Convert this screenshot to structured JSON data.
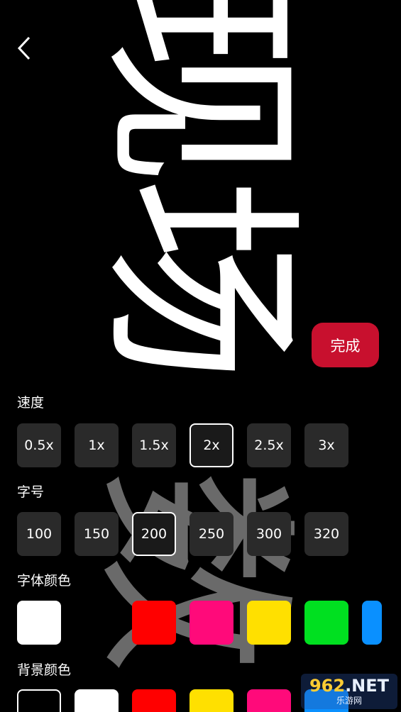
{
  "marquee": {
    "main_text": "现场",
    "trail_text": "数",
    "text_color": "#ffffff",
    "trail_color": "#6a6a6a"
  },
  "header": {
    "back_icon": "chevron-left-icon"
  },
  "actions": {
    "done_label": "完成",
    "done_color": "#c8102e"
  },
  "speed": {
    "label": "速度",
    "options": [
      "0.5x",
      "1x",
      "1.5x",
      "2x",
      "2.5x",
      "3x"
    ],
    "selected": "2x"
  },
  "font_size": {
    "label": "字号",
    "options": [
      "100",
      "150",
      "200",
      "250",
      "300",
      "320"
    ],
    "selected": "200"
  },
  "font_color": {
    "label": "字体颜色",
    "swatches": [
      "#ffffff",
      "",
      "#ff0000",
      "#ff0a7a",
      "#ffe000",
      "#00e020",
      "#0a90ff"
    ]
  },
  "bg_color": {
    "label": "背景颜色",
    "swatches": [
      "#000000",
      "#ffffff",
      "#ff0000",
      "#ffe000",
      "#ff0a7a",
      "#0a90ff"
    ],
    "selected": "#000000"
  },
  "watermark": {
    "big_prefix": "962",
    "big_suffix": ".NET",
    "small": "乐游网"
  }
}
